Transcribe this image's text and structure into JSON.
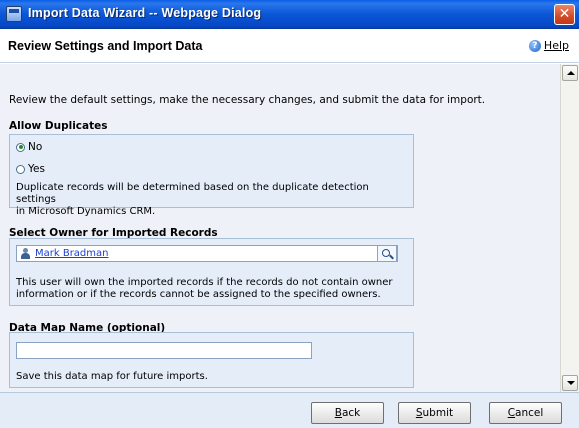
{
  "window": {
    "title": "Import Data Wizard -- Webpage Dialog",
    "close_glyph": "✕"
  },
  "header": {
    "title": "Review Settings and Import Data",
    "help_label": "Help",
    "help_icon": "help-icon"
  },
  "intro": "Review the default settings, make the necessary changes, and submit the data for import.",
  "allow_duplicates": {
    "heading": "Allow Duplicates",
    "options": [
      {
        "label": "No",
        "checked": true
      },
      {
        "label": "Yes",
        "checked": false
      }
    ],
    "note_line1": "Duplicate records will be determined based on the duplicate detection settings",
    "note_line2": "in Microsoft Dynamics CRM."
  },
  "owner": {
    "heading": "Select Owner for Imported Records",
    "selected_owner": "Mark Bradman",
    "user_icon": "user-icon",
    "lookup_icon": "lookup-icon",
    "note_line1": "This user will own the imported records if the records do not contain owner",
    "note_line2": "information or if the records cannot be assigned to the specified owners."
  },
  "data_map": {
    "heading": "Data Map Name (optional)",
    "value": "",
    "placeholder": "",
    "note": "Save this data map for future imports."
  },
  "footer": {
    "back": {
      "accel": "B",
      "rest": "ack"
    },
    "submit": {
      "accel": "S",
      "rest": "ubmit"
    },
    "cancel": {
      "accel": "C",
      "rest": "ancel"
    }
  },
  "colors": {
    "titlebar": "#0a57d6",
    "panel_bg": "#e4edf8",
    "panel_border": "#a9bfd6",
    "link": "#1d3ecf"
  }
}
